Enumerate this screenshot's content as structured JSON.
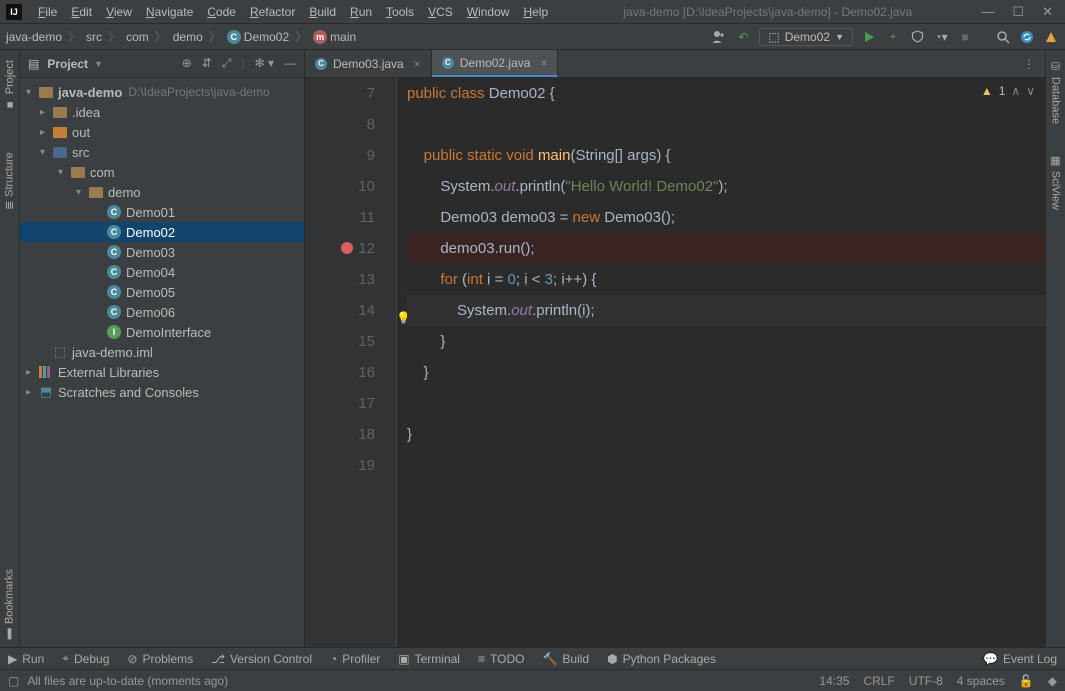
{
  "window": {
    "title": "java-demo [D:\\IdeaProjects\\java-demo] - Demo02.java"
  },
  "menubar": [
    "File",
    "Edit",
    "View",
    "Navigate",
    "Code",
    "Refactor",
    "Build",
    "Run",
    "Tools",
    "VCS",
    "Window",
    "Help"
  ],
  "breadcrumbs": [
    {
      "label": "java-demo",
      "icon": null
    },
    {
      "label": "src",
      "icon": null
    },
    {
      "label": "com",
      "icon": null
    },
    {
      "label": "demo",
      "icon": null
    },
    {
      "label": "Demo02",
      "icon": "class"
    },
    {
      "label": "main",
      "icon": "method"
    }
  ],
  "run_config": {
    "label": "Demo02"
  },
  "sidebar": {
    "title": "Project",
    "tree": {
      "root": {
        "label": "java-demo",
        "path": "D:\\IdeaProjects\\java-demo"
      },
      "idea": ".idea",
      "out": "out",
      "src": "src",
      "com": "com",
      "demo": "demo",
      "classes": [
        "Demo01",
        "Demo02",
        "Demo03",
        "Demo04",
        "Demo05",
        "Demo06"
      ],
      "iface": "DemoInterface",
      "iml": "java-demo.iml",
      "ext": "External Libraries",
      "scratch": "Scratches and Consoles"
    }
  },
  "left_tabs": {
    "project": "Project",
    "structure": "Structure",
    "bookmarks": "Bookmarks"
  },
  "right_tabs": {
    "database": "Database",
    "sciview": "SciView"
  },
  "editor_tabs": [
    {
      "label": "Demo03.java",
      "active": false
    },
    {
      "label": "Demo02.java",
      "active": true
    }
  ],
  "inspection": {
    "warnings": "1"
  },
  "code": {
    "first_line": 7,
    "lines": [
      {
        "n": 7,
        "run": true,
        "html": "<span class='kw'>public</span> <span class='kw'>class</span> <span class='cls'>Demo02</span> <span class='pun'>{</span>"
      },
      {
        "n": 8,
        "html": ""
      },
      {
        "n": 9,
        "run": true,
        "html": "    <span class='kw'>public</span> <span class='kw'>static</span> <span class='kw'>void</span> <span class='mth'>main</span><span class='pun'>(</span><span class='id'>String[] args</span><span class='pun'>) {</span>"
      },
      {
        "n": 10,
        "html": "        <span class='id'>System</span><span class='pun'>.</span><span class='fld'>out</span><span class='pun'>.</span><span class='id'>println</span><span class='pun'>(</span><span class='str'>\"Hello World! Demo02\"</span><span class='pun'>);</span>"
      },
      {
        "n": 11,
        "html": "        <span class='id'>Demo03 demo03</span> <span class='pun'>=</span> <span class='kw'>new</span> <span class='id'>Demo03</span><span class='pun'>();</span>"
      },
      {
        "n": 12,
        "bp": true,
        "html": "        <span class='id'>demo03</span><span class='pun'>.</span><span class='id'>run</span><span class='pun'>();</span>"
      },
      {
        "n": 13,
        "html": "        <span class='kw'>for</span> <span class='pun'>(</span><span class='kw'>int</span> <span class='id uline'>i</span> <span class='pun'>=</span> <span class='num'>0</span><span class='pun'>;</span> <span class='id uline'>i</span> <span class='pun'>&lt;</span> <span class='num'>3</span><span class='pun'>;</span> <span class='id uline'>i</span><span class='pun'>++) {</span>"
      },
      {
        "n": 14,
        "cur": true,
        "bulb": true,
        "html": "            <span class='id'>System</span><span class='pun'>.</span><span class='fld'>out</span><span class='pun'>.</span><span class='id'>println</span><span class='pun'>(</span><span class='id uline'>i</span><span class='pun'>);</span>"
      },
      {
        "n": 15,
        "html": "        <span class='pun'>}</span>"
      },
      {
        "n": 16,
        "html": "    <span class='pun'>}</span>"
      },
      {
        "n": 17,
        "html": ""
      },
      {
        "n": 18,
        "html": "<span class='pun'>}</span>"
      },
      {
        "n": 19,
        "html": ""
      }
    ]
  },
  "bottom_tools": [
    {
      "icon": "play",
      "label": "Run"
    },
    {
      "icon": "bug",
      "label": "Debug"
    },
    {
      "icon": "warn",
      "label": "Problems"
    },
    {
      "icon": "vcs",
      "label": "Version Control"
    },
    {
      "icon": "profiler",
      "label": "Profiler"
    },
    {
      "icon": "terminal",
      "label": "Terminal"
    },
    {
      "icon": "todo",
      "label": "TODO"
    },
    {
      "icon": "build",
      "label": "Build"
    },
    {
      "icon": "python",
      "label": "Python Packages"
    }
  ],
  "event_log": "Event Log",
  "status": {
    "msg": "All files are up-to-date (moments ago)",
    "pos": "14:35",
    "eol": "CRLF",
    "enc": "UTF-8",
    "indent": "4 spaces"
  }
}
